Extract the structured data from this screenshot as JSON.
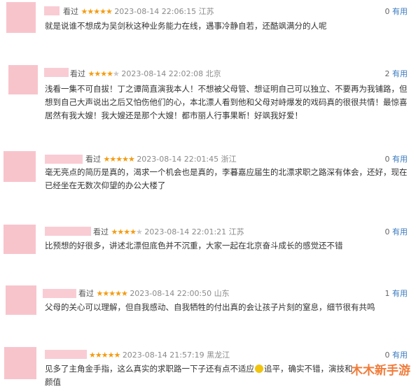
{
  "reviews": [
    {
      "watched_label": "看过",
      "rating": 5,
      "date": "2023-08-14 22:06:15",
      "location": "江苏",
      "votes": "0",
      "useful_label": "有用",
      "content": "就是说谁不想成为吴剑秋这种业务能力在线，遇事冷静自若，还酷飒满分的人呢"
    },
    {
      "watched_label": "看过",
      "rating": 4,
      "date": "2023-08-14 22:02:08",
      "location": "北京",
      "votes": "2",
      "useful_label": "有用",
      "content": "浅看一集不可自拔！丁之谭简直演我本人！不想被父母管、想证明自己可以独立、不要再为我铺路，但想到自己大声说出之后又怕伤他们的心，本北漂人看到他和父母对峙爆发的戏码真的很很共情！最惊喜居然有我大嫂！我大嫂还是那个大嫂！都市丽人行事果断！好飒我好爱！"
    },
    {
      "watched_label": "看过",
      "rating": 5,
      "date": "2023-08-14 22:01:45",
      "location": "浙江",
      "votes": "0",
      "useful_label": "有用",
      "content": "毫无亮点的简历是真的，渴求一个机会也是真的，李暮嘉应届生的北漂求职之路深有体会，还好，现在已经坐在无数次仰望的办公大楼了"
    },
    {
      "watched_label": "看过",
      "rating": 4,
      "date": "2023-08-14 22:01:21",
      "location": "江苏",
      "votes": "0",
      "useful_label": "有用",
      "content": "比预想的好很多，讲述北漂但底色并不沉重，大家一起在北京奋斗成长的感觉还不错"
    },
    {
      "watched_label": "看过",
      "rating": 5,
      "date": "2023-08-14 22:00:50",
      "location": "山东",
      "votes": "1",
      "useful_label": "有用",
      "content": "父母的关心可以理解，但自我感动、自我牺牲的付出真的会让孩子片刻的窒息，细节很有共鸣"
    },
    {
      "watched_label": "看过",
      "rating": 5,
      "date": "2023-08-14 21:57:19",
      "location": "黑龙江",
      "votes": "0",
      "useful_label": "有用",
      "content_a": "见多了主角金手指，这么真实的求职路一下子还有点不适应",
      "content_b": "追平，确实不错，演技和",
      "content_c": "颜值"
    }
  ],
  "watermark": "木木新手游",
  "colors": {
    "avatar": "#f8c4cc",
    "star": "#f39c12",
    "useful": "#3a7abf"
  }
}
